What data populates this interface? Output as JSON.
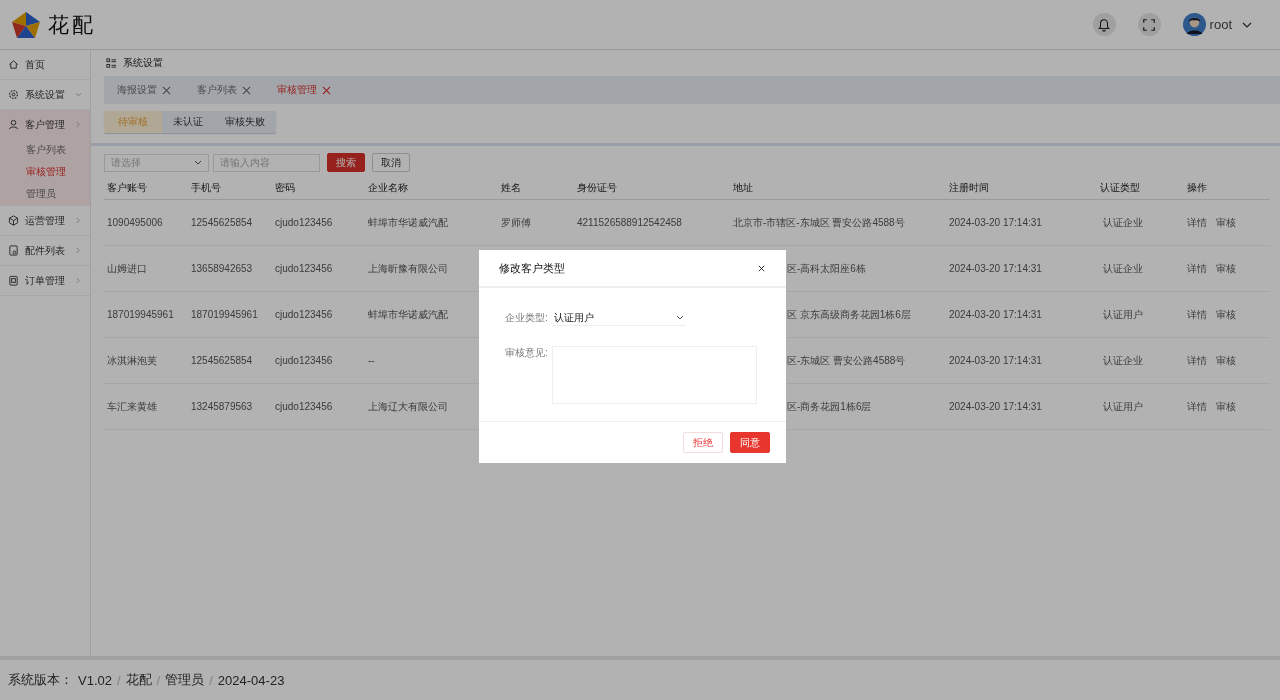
{
  "header": {
    "logo_text": "花配",
    "user": "root"
  },
  "sidebar": {
    "items": [
      {
        "label": "首页",
        "expanded": false
      },
      {
        "label": "系统设置",
        "expanded": false
      },
      {
        "label": "客户管理",
        "expanded": true,
        "children": [
          {
            "label": "客户列表",
            "selected": false
          },
          {
            "label": "审核管理",
            "selected": true
          },
          {
            "label": "管理员",
            "selected": false
          }
        ]
      },
      {
        "label": "运营管理",
        "expanded": false
      },
      {
        "label": "配件列表",
        "expanded": false
      },
      {
        "label": "订单管理",
        "expanded": false
      }
    ]
  },
  "breadcrumb": "系统设置",
  "tags": [
    {
      "label": "海报设置",
      "selected": false
    },
    {
      "label": "客户列表",
      "selected": false
    },
    {
      "label": "审核管理",
      "selected": true
    }
  ],
  "subtabs": [
    {
      "label": "待审核",
      "selected": true
    },
    {
      "label": "未认证",
      "selected": false
    },
    {
      "label": "审核失败",
      "selected": false
    }
  ],
  "filter": {
    "select_placeholder": "请选择",
    "input_placeholder": "请输入内容",
    "search_button": "搜索",
    "cancel_button": "取消"
  },
  "table": {
    "columns": [
      "客户账号",
      "手机号",
      "密码",
      "企业名称",
      "姓名",
      "身份证号",
      "地址",
      "注册时间",
      "认证类型",
      "操作"
    ],
    "rows": [
      {
        "account": "1090495006",
        "phone": "12545625854",
        "password": "cjudo123456",
        "company": "蚌埠市华诺威汽配",
        "name": "罗师傅",
        "id_number": "4211526588912542458",
        "address": "北京市-市辖区-东城区 曹安公路4588号",
        "address_cut": false,
        "time": "2024-03-20 17:14:31",
        "auth_type": "认证企业",
        "actions": [
          "详情",
          "审核"
        ]
      },
      {
        "account": "山姆进口",
        "phone": "13658942653",
        "password": "cjudo123456",
        "company": "上海昕豫有限公司",
        "address": "区-高科太阳座6栋",
        "address_cut": true,
        "time": "2024-03-20 17:14:31",
        "auth_type": "认证企业",
        "actions": [
          "详情",
          "审核"
        ]
      },
      {
        "account": "187019945961",
        "phone": "187019945961",
        "password": "cjudo123456",
        "company": "蚌埠市华诺威汽配",
        "address": "区 京东高级商务花园1栋6层",
        "address_cut": true,
        "time": "2024-03-20 17:14:31",
        "auth_type": "认证用户",
        "actions": [
          "详情",
          "审核"
        ]
      },
      {
        "account": "冰淇淋泡芙",
        "phone": "12545625854",
        "password": "cjudo123456",
        "company": "--",
        "address": "区-东城区 曹安公路4588号",
        "address_cut": true,
        "time": "2024-03-20 17:14:31",
        "auth_type": "认证企业",
        "actions": [
          "详情",
          "审核"
        ]
      },
      {
        "account": "车汇来黄雄",
        "phone": "13245879563",
        "password": "cjudo123456",
        "company": "上海辽大有限公司",
        "address": "区-商务花园1栋6层",
        "address_cut": true,
        "time": "2024-03-20 17:14:31",
        "auth_type": "认证用户",
        "actions": [
          "详情",
          "审核"
        ]
      }
    ]
  },
  "dialog": {
    "title": "修改客户类型",
    "type_label": "企业类型:",
    "type_value": "认证用户",
    "comment_label": "审核意见:",
    "reject_button": "拒绝",
    "approve_button": "同意"
  },
  "footer": {
    "label": "系统版本：",
    "separator": "/",
    "items": [
      "V1.02",
      "花配",
      "管理员",
      "2024-04-23"
    ]
  }
}
